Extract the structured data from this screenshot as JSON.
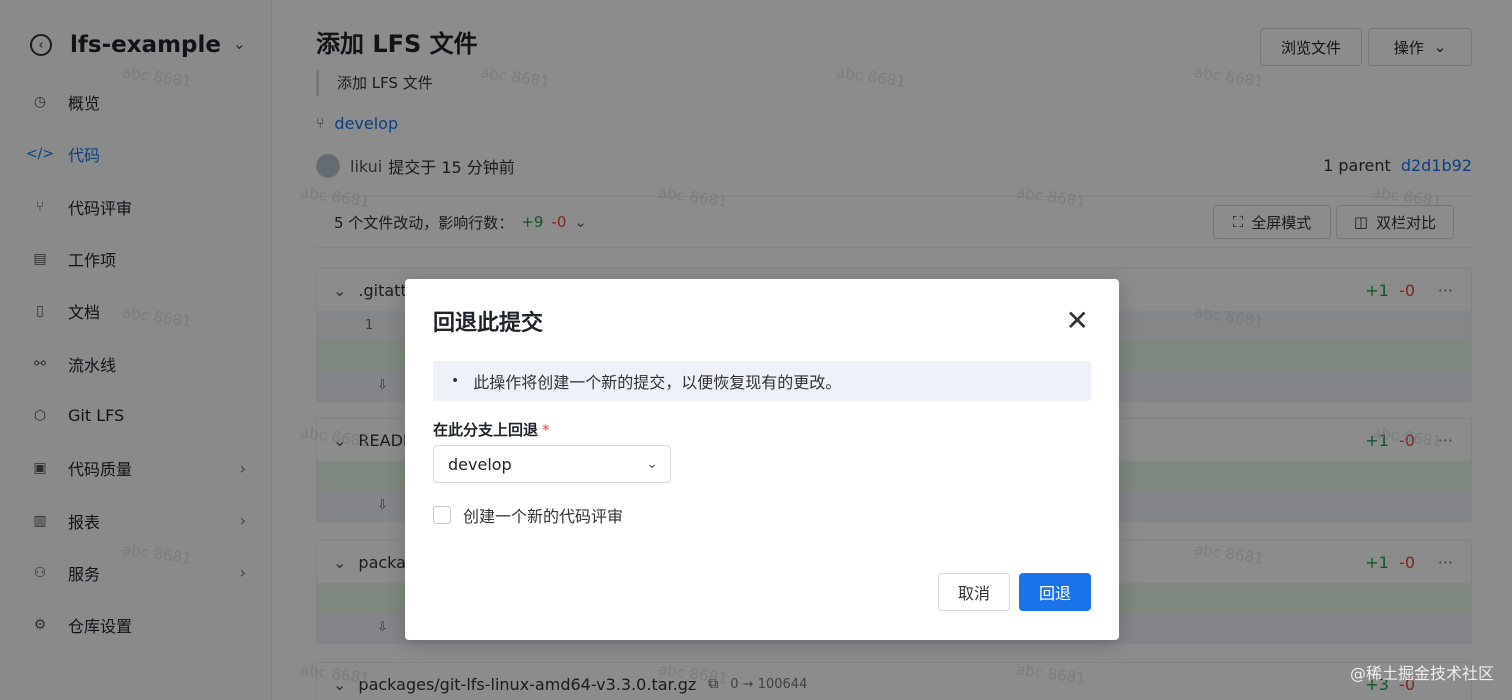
{
  "sidebar": {
    "repo_name": "lfs-example",
    "items": [
      {
        "label": "概览",
        "icon": "dashboard-icon",
        "glyph": "◷"
      },
      {
        "label": "代码",
        "icon": "code-icon",
        "glyph": "</>"
      },
      {
        "label": "代码评审",
        "icon": "merge-request-icon",
        "glyph": "⑂"
      },
      {
        "label": "工作项",
        "icon": "task-icon",
        "glyph": "▤"
      },
      {
        "label": "文档",
        "icon": "book-icon",
        "glyph": "▯"
      },
      {
        "label": "流水线",
        "icon": "pipeline-icon",
        "glyph": "⚯"
      },
      {
        "label": "Git LFS",
        "icon": "lfs-icon",
        "glyph": "⬡"
      },
      {
        "label": "代码质量",
        "icon": "quality-icon",
        "glyph": "▣"
      },
      {
        "label": "报表",
        "icon": "chart-icon",
        "glyph": "▥"
      },
      {
        "label": "服务",
        "icon": "service-icon",
        "glyph": "⚇"
      },
      {
        "label": "仓库设置",
        "icon": "settings-icon",
        "glyph": "⚙"
      }
    ],
    "active_index": 1
  },
  "header": {
    "title": "添加 LFS 文件",
    "browse_button": "浏览文件",
    "actions_button": "操作"
  },
  "commit": {
    "message": "添加 LFS 文件",
    "branch": "develop",
    "author": "likui",
    "committed_text": "提交于 15 分钟前",
    "parent_label": "1 parent",
    "parent_sha": "d2d1b92"
  },
  "stats": {
    "summary": "5 个文件改动，影响行数：",
    "additions": "+9",
    "deletions": "-0",
    "fullscreen_button": "全屏模式",
    "split_button": "双栏对比"
  },
  "files": [
    {
      "name": ".gitattr",
      "additions": "+1",
      "deletions": "-0",
      "line": "1"
    },
    {
      "name": "READM",
      "additions": "+1",
      "deletions": "-0"
    },
    {
      "name": "packag",
      "additions": "+1",
      "deletions": "-0"
    },
    {
      "name": "packages/git-lfs-linux-amd64-v3.3.0.tar.gz",
      "mode": "0 → 100644",
      "additions": "+3",
      "deletions": "-0"
    }
  ],
  "watermark": "abc 8681",
  "modal": {
    "title": "回退此提交",
    "notice": "此操作将创建一个新的提交，以便恢复现有的更改。",
    "field_label": "在此分支上回退",
    "required_mark": "*",
    "branch_value": "develop",
    "checkbox_label": "创建一个新的代码评审",
    "cancel": "取消",
    "confirm": "回退"
  },
  "corner_text": "@稀土掘金技术社区",
  "colors": {
    "accent": "#1a73e8",
    "addition": "#1e9e4a",
    "deletion": "#e5453a"
  }
}
